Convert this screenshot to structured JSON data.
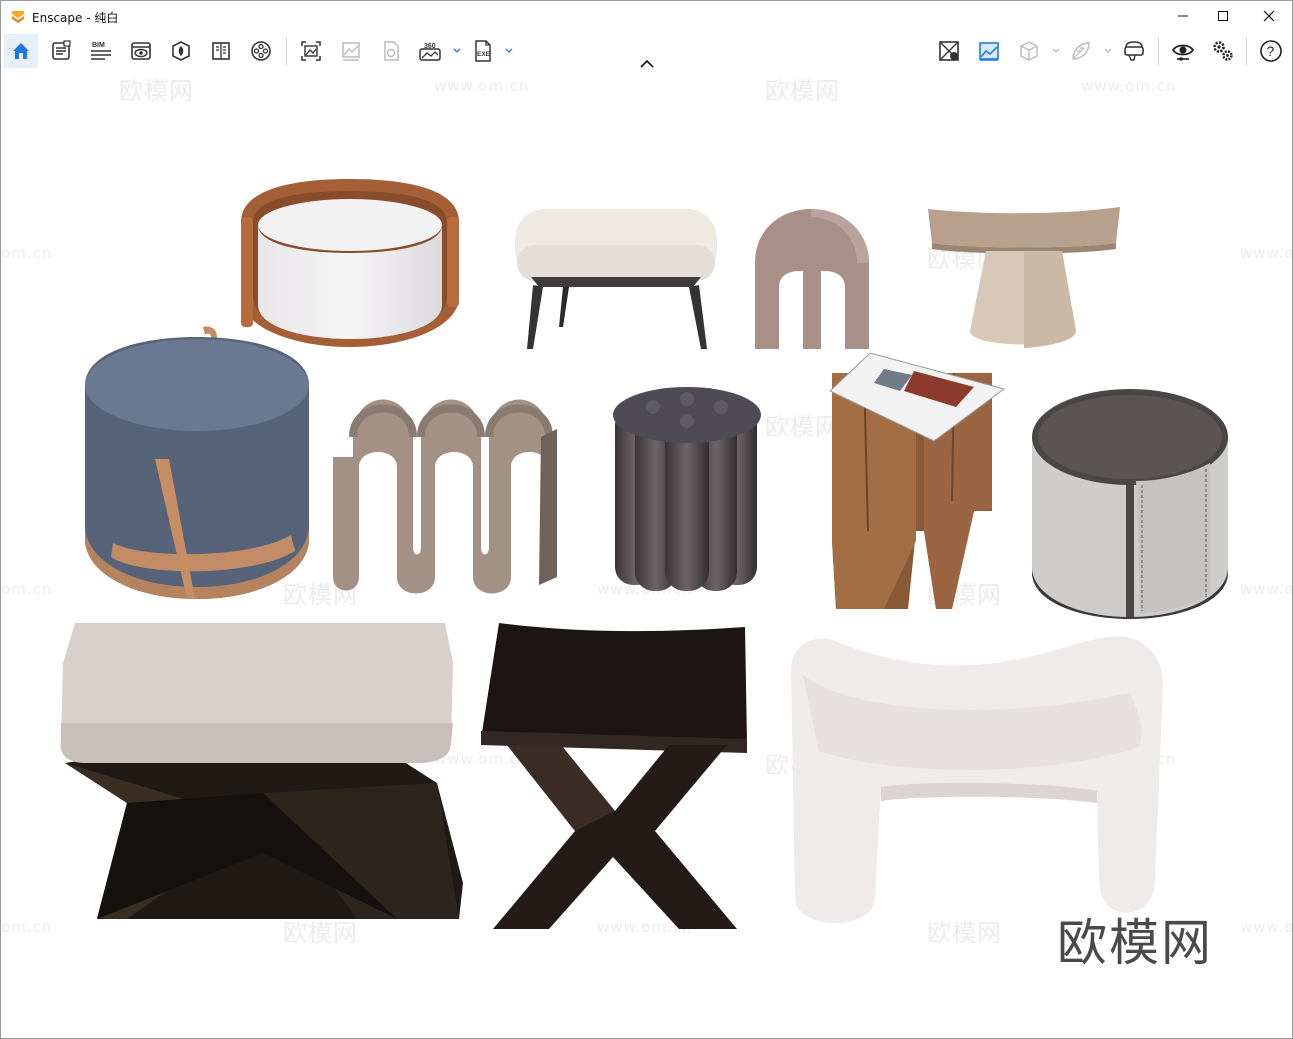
{
  "window": {
    "app_name": "Enscape",
    "title": "Enscape - 纯白",
    "accent_color": "#f5a623",
    "active_color": "#1f7ae0"
  },
  "toolbar": {
    "left_items": [
      {
        "icon": "home-icon"
      },
      {
        "icon": "screenshot-list-icon"
      },
      {
        "icon": "bim-icon",
        "text": "BIM"
      },
      {
        "icon": "view-management-icon"
      },
      {
        "icon": "asset-library-icon"
      },
      {
        "icon": "material-editor-icon"
      },
      {
        "icon": "video-editor-icon"
      },
      {
        "icon": "render-image-icon"
      },
      {
        "icon": "batch-render-icon"
      },
      {
        "icon": "render-panorama-icon"
      },
      {
        "icon": "export-360-icon",
        "text": "360"
      },
      {
        "icon": "export-exe-icon",
        "text": "EXE"
      }
    ],
    "right_items": [
      {
        "icon": "live-updates-icon"
      },
      {
        "icon": "sync-views-icon"
      },
      {
        "icon": "orthographic-icon"
      },
      {
        "icon": "capture-settings-icon"
      },
      {
        "icon": "vr-headset-icon"
      },
      {
        "icon": "visual-settings-icon"
      },
      {
        "icon": "general-settings-icon"
      },
      {
        "icon": "help-icon",
        "text": "?"
      }
    ]
  },
  "watermark": {
    "brand_text": "欧模网",
    "site_text": "www.om.cn",
    "partial_site_text": "om.cn",
    "partial_site_text_right": "www.o"
  }
}
